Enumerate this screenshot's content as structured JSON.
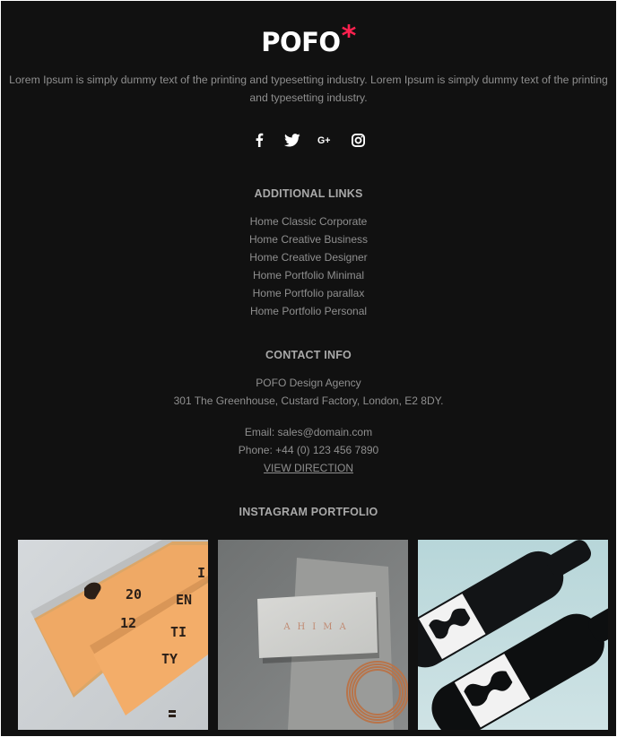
{
  "brand": {
    "name": "POFO",
    "mark": "*",
    "accent_color": "#ff214f"
  },
  "about": "Lorem Ipsum is simply dummy text of the printing and typesetting industry. Lorem Ipsum is simply dummy text of the printing and typesetting industry.",
  "social": [
    {
      "icon": "facebook-icon"
    },
    {
      "icon": "twitter-icon"
    },
    {
      "icon": "google-plus-icon",
      "label": "G+"
    },
    {
      "icon": "instagram-icon"
    }
  ],
  "additional_links": {
    "heading": "ADDITIONAL LINKS",
    "items": [
      "Home Classic Corporate",
      "Home Creative Business",
      "Home Creative Designer",
      "Home Portfolio Minimal",
      "Home Portfolio parallax",
      "Home Portfolio Personal"
    ]
  },
  "contact": {
    "heading": "CONTACT INFO",
    "company": "POFO Design Agency",
    "address": "301 The Greenhouse, Custard Factory, London, E2 8DY.",
    "email": "Email: sales@domain.com",
    "phone": "Phone: +44 (0) 123 456 7890",
    "direction_link": "VIEW DIRECTION"
  },
  "instagram": {
    "heading": "INSTAGRAM PORTFOLIO",
    "images": [
      {
        "name": "orange-identity-booklet-image",
        "letters": [
          "I",
          "EN",
          "20",
          "TI",
          "12",
          "TY"
        ]
      },
      {
        "name": "business-card-image",
        "text": "AHIMA"
      },
      {
        "name": "wine-bottles-image"
      }
    ]
  },
  "colors": {
    "background": "#111111",
    "heading": "#a9a9a9",
    "body_text": "#8f8f8f"
  }
}
